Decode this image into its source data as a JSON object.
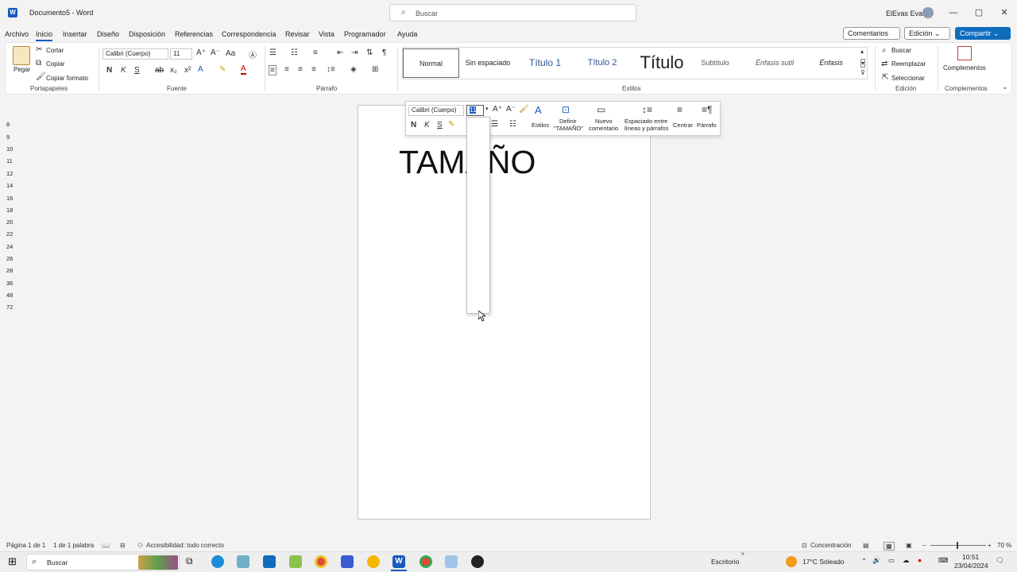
{
  "window": {
    "title": "Documento5 - Word",
    "search_placeholder": "Buscar",
    "user": "ElEvas Evas",
    "min": "—",
    "max": "▢",
    "close": "✕"
  },
  "menu": {
    "items": [
      "Archivo",
      "Inicio",
      "Insertar",
      "Diseño",
      "Disposición",
      "Referencias",
      "Correspondencia",
      "Revisar",
      "Vista",
      "Programador",
      "Ayuda"
    ],
    "comments": "Comentarios",
    "edition": "Edición",
    "share": "Compartir"
  },
  "ribbon": {
    "clipboard": {
      "paste": "Pegar",
      "cut": "Cortar",
      "copy": "Copiar",
      "format_painter": "Copiar formato",
      "label": "Portapapeles"
    },
    "font": {
      "name": "Calibri (Cuerpo)",
      "size": "11",
      "bold": "N",
      "italic": "K",
      "underline": "S",
      "label": "Fuente"
    },
    "paragraph": {
      "label": "Párrafo"
    },
    "styles": {
      "items": [
        "Normal",
        "Sin espaciado",
        "Título 1",
        "Título 2",
        "Título",
        "Subtítulo",
        "Énfasis sutil",
        "Énfasis"
      ],
      "label": "Estilos"
    },
    "editing": {
      "find": "Buscar",
      "replace": "Reemplazar",
      "select": "Seleccionar",
      "label": "Edición"
    },
    "addins": {
      "button": "Complementos",
      "label": "Complementos"
    }
  },
  "document": {
    "text": "TAMAÑO"
  },
  "minibar": {
    "font": "Calibri (Cuerpo)",
    "size": "11",
    "styles": "Estilos",
    "define": "Definir \"TAMAÑO\"",
    "define_1": "Definir",
    "define_2": "\"TAMAÑO\"",
    "comment_1": "Nuevo",
    "comment_2": "comentario",
    "spacing_1": "Espaciado entre",
    "spacing_2": "líneas y párrafos",
    "center": "Centrar",
    "paragraph": "Párrafo",
    "bold": "N",
    "italic": "K",
    "underline": "S"
  },
  "size_options": [
    "8",
    "9",
    "10",
    "11",
    "12",
    "14",
    "16",
    "18",
    "20",
    "22",
    "24",
    "26",
    "28",
    "36",
    "48",
    "72"
  ],
  "status": {
    "page": "Página 1 de 1",
    "words": "1 de 1 palabra",
    "accessibility": "Accesibilidad: todo correcto",
    "focus": "Concentración",
    "zoom": "70 %"
  },
  "taskbar": {
    "search": "Buscar",
    "desktop": "Escritorio",
    "weather": "17°C  Soleado",
    "time": "10:51",
    "date": "23/04/2024"
  },
  "colors": {
    "accent": "#185abd",
    "share": "#0f6cbd"
  }
}
